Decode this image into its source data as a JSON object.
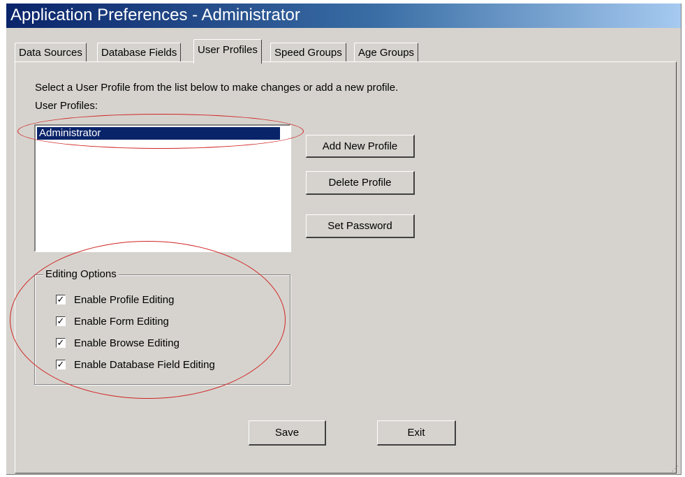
{
  "window": {
    "title": "Application Preferences - Administrator"
  },
  "tabs": [
    {
      "label": "Data Sources",
      "active": false
    },
    {
      "label": "Database Fields",
      "active": false
    },
    {
      "label": "User Profiles",
      "active": true
    },
    {
      "label": "Speed Groups",
      "active": false
    },
    {
      "label": "Age Groups",
      "active": false
    }
  ],
  "panel": {
    "instructions": "Select a User Profile from the list below to make changes or add a new profile.",
    "list_label": "User Profiles:",
    "profiles": [
      {
        "name": "Administrator",
        "selected": true
      }
    ],
    "buttons": {
      "add": "Add New Profile",
      "delete": "Delete Profile",
      "password": "Set Password"
    },
    "editing_options": {
      "title": "Editing Options",
      "options": [
        {
          "label": "Enable Profile Editing",
          "checked": true
        },
        {
          "label": "Enable Form Editing",
          "checked": true
        },
        {
          "label": "Enable Browse Editing",
          "checked": true
        },
        {
          "label": "Enable Database Field Editing",
          "checked": true
        }
      ]
    }
  },
  "footer": {
    "save": "Save",
    "exit": "Exit"
  },
  "colors": {
    "window_bg": "#d6d3ce",
    "title_gradient_start": "#0a246a",
    "title_gradient_end": "#a6caf0",
    "selection": "#0a246a",
    "annotation": "#d02424"
  },
  "icons": {
    "checkmark": "check-icon",
    "resize_grip": "resize-grip-icon"
  }
}
